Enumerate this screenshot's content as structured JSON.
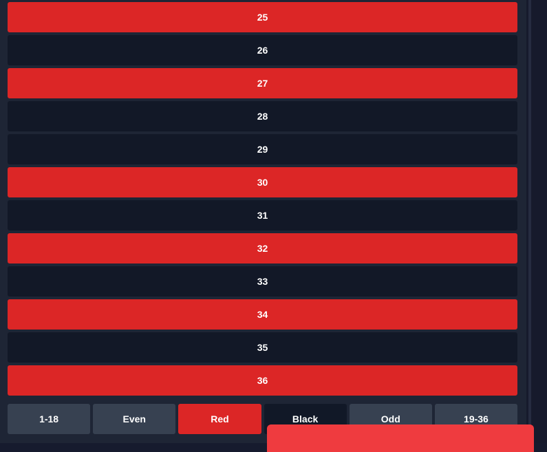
{
  "numbers": [
    {
      "label": "25",
      "color": "red"
    },
    {
      "label": "26",
      "color": "black"
    },
    {
      "label": "27",
      "color": "red"
    },
    {
      "label": "28",
      "color": "black"
    },
    {
      "label": "29",
      "color": "black"
    },
    {
      "label": "30",
      "color": "red"
    },
    {
      "label": "31",
      "color": "black"
    },
    {
      "label": "32",
      "color": "red"
    },
    {
      "label": "33",
      "color": "black"
    },
    {
      "label": "34",
      "color": "red"
    },
    {
      "label": "35",
      "color": "black"
    },
    {
      "label": "36",
      "color": "red"
    }
  ],
  "outside_bets": [
    {
      "label": "1-18",
      "color": "gray"
    },
    {
      "label": "Even",
      "color": "gray"
    },
    {
      "label": "Red",
      "color": "red"
    },
    {
      "label": "Black",
      "color": "black"
    },
    {
      "label": "Odd",
      "color": "gray"
    },
    {
      "label": "19-36",
      "color": "gray"
    }
  ],
  "colors": {
    "red": "#dc2626",
    "black": "#121827",
    "gray": "#374151",
    "toast": "#ef3b3f"
  }
}
